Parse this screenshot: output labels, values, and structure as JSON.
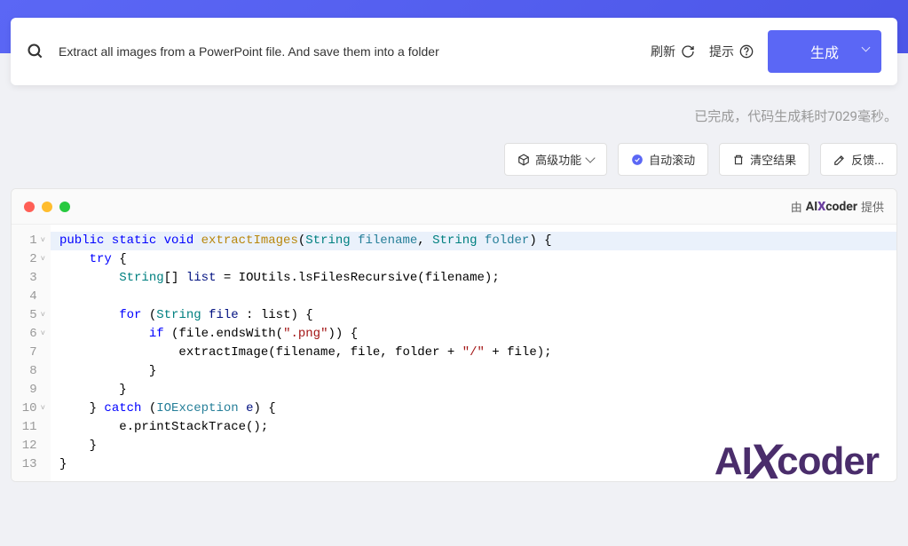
{
  "search": {
    "value": "Extract all images from a PowerPoint file. And save them into a folder"
  },
  "actions": {
    "refresh": "刷新",
    "hint": "提示",
    "generate": "生成"
  },
  "status": "已完成，代码生成耗时7029毫秒。",
  "toolbar": {
    "advanced": "高级功能",
    "autoscroll": "自动滚动",
    "clear": "清空结果",
    "feedback": "反馈..."
  },
  "panel": {
    "powered_prefix": "由",
    "powered_brand_ai": "AI",
    "powered_brand_x": "X",
    "powered_brand_coder": "coder",
    "powered_suffix": "提供"
  },
  "code": {
    "lines": [
      {
        "n": 1,
        "fold": true,
        "tokens": [
          {
            "t": "public static void ",
            "c": "kw"
          },
          {
            "t": "extractImages",
            "c": "fn"
          },
          {
            "t": "(",
            "c": ""
          },
          {
            "t": "String ",
            "c": "type"
          },
          {
            "t": "filename",
            "c": "param"
          },
          {
            "t": ", ",
            "c": ""
          },
          {
            "t": "String ",
            "c": "type"
          },
          {
            "t": "folder",
            "c": "param"
          },
          {
            "t": ") {",
            "c": ""
          }
        ]
      },
      {
        "n": 2,
        "fold": true,
        "tokens": [
          {
            "t": "    ",
            "c": ""
          },
          {
            "t": "try ",
            "c": "kw"
          },
          {
            "t": "{",
            "c": ""
          }
        ]
      },
      {
        "n": 3,
        "fold": false,
        "tokens": [
          {
            "t": "        ",
            "c": ""
          },
          {
            "t": "String",
            "c": "type"
          },
          {
            "t": "[] ",
            "c": ""
          },
          {
            "t": "list",
            "c": "var"
          },
          {
            "t": " = IOUtils.lsFilesRecursive(filename);",
            "c": ""
          }
        ]
      },
      {
        "n": 4,
        "fold": false,
        "tokens": [
          {
            "t": "",
            "c": ""
          }
        ]
      },
      {
        "n": 5,
        "fold": true,
        "tokens": [
          {
            "t": "        ",
            "c": ""
          },
          {
            "t": "for ",
            "c": "kw"
          },
          {
            "t": "(",
            "c": ""
          },
          {
            "t": "String ",
            "c": "type"
          },
          {
            "t": "file",
            "c": "var"
          },
          {
            "t": " : list) {",
            "c": ""
          }
        ]
      },
      {
        "n": 6,
        "fold": true,
        "tokens": [
          {
            "t": "            ",
            "c": ""
          },
          {
            "t": "if ",
            "c": "kw"
          },
          {
            "t": "(file.endsWith(",
            "c": ""
          },
          {
            "t": "\".png\"",
            "c": "str"
          },
          {
            "t": ")) {",
            "c": ""
          }
        ]
      },
      {
        "n": 7,
        "fold": false,
        "tokens": [
          {
            "t": "                extractImage(filename, file, folder + ",
            "c": ""
          },
          {
            "t": "\"/\"",
            "c": "str"
          },
          {
            "t": " + file);",
            "c": ""
          }
        ]
      },
      {
        "n": 8,
        "fold": false,
        "tokens": [
          {
            "t": "            }",
            "c": ""
          }
        ]
      },
      {
        "n": 9,
        "fold": false,
        "tokens": [
          {
            "t": "        }",
            "c": ""
          }
        ]
      },
      {
        "n": 10,
        "fold": true,
        "tokens": [
          {
            "t": "    } ",
            "c": ""
          },
          {
            "t": "catch ",
            "c": "kw"
          },
          {
            "t": "(",
            "c": ""
          },
          {
            "t": "IOException ",
            "c": "exc"
          },
          {
            "t": "e",
            "c": "var"
          },
          {
            "t": ") {",
            "c": ""
          }
        ]
      },
      {
        "n": 11,
        "fold": false,
        "tokens": [
          {
            "t": "        e.printStackTrace();",
            "c": ""
          }
        ]
      },
      {
        "n": 12,
        "fold": false,
        "tokens": [
          {
            "t": "    }",
            "c": ""
          }
        ]
      },
      {
        "n": 13,
        "fold": false,
        "tokens": [
          {
            "t": "}",
            "c": ""
          }
        ]
      }
    ]
  },
  "watermark": {
    "ai": "AI",
    "x": "X",
    "coder": "coder"
  }
}
